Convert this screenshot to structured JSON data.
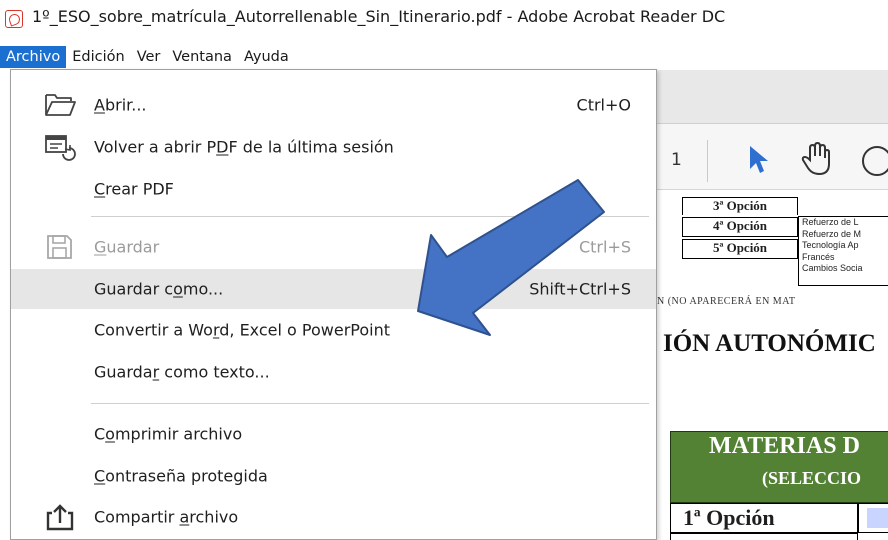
{
  "window": {
    "title": "1º_ESO_sobre_matrícula_Autorrellenable_Sin_Itinerario.pdf - Adobe Acrobat Reader DC"
  },
  "menubar": {
    "items": [
      "Archivo",
      "Edición",
      "Ver",
      "Ventana",
      "Ayuda"
    ],
    "active": "Archivo"
  },
  "file_menu": {
    "items": [
      {
        "pre": "",
        "ul": "A",
        "post": "brir...",
        "shortcut": "Ctrl+O",
        "icon": "folder-open-icon",
        "disabled": false,
        "hovered": false
      },
      {
        "pre": "Volver a abrir P",
        "ul": "D",
        "post": "F de la última sesión",
        "shortcut": "",
        "icon": "reopen-pdf-icon",
        "disabled": false,
        "hovered": false
      },
      {
        "pre": "",
        "ul": "C",
        "post": "rear PDF",
        "shortcut": "",
        "icon": "",
        "disabled": false,
        "hovered": false
      },
      {
        "pre": "",
        "ul": "G",
        "post": "uardar",
        "shortcut": "Ctrl+S",
        "icon": "save-icon",
        "disabled": true,
        "hovered": false
      },
      {
        "pre": "Guardar c",
        "ul": "o",
        "post": "mo...",
        "shortcut": "Shift+Ctrl+S",
        "icon": "",
        "disabled": false,
        "hovered": true
      },
      {
        "pre": "Convertir a Wo",
        "ul": "r",
        "post": "d, Excel o PowerPoint",
        "shortcut": "",
        "icon": "",
        "disabled": false,
        "hovered": false
      },
      {
        "pre": "Guarda",
        "ul": "r",
        "post": " como texto...",
        "shortcut": "",
        "icon": "",
        "disabled": false,
        "hovered": false
      },
      {
        "pre": "C",
        "ul": "o",
        "post": "mprimir archivo",
        "shortcut": "",
        "icon": "",
        "disabled": false,
        "hovered": false
      },
      {
        "pre": "",
        "ul": "C",
        "post": "ontraseña protegida",
        "shortcut": "",
        "icon": "",
        "disabled": false,
        "hovered": false
      },
      {
        "pre": "Compartir ",
        "ul": "a",
        "post": "rchivo",
        "shortcut": "",
        "icon": "share-icon",
        "disabled": false,
        "hovered": false
      }
    ]
  },
  "toolbar": {
    "page_number": "1"
  },
  "document": {
    "options": [
      "3ª Opción",
      "4ª Opción",
      "5ª Opción"
    ],
    "subjects": [
      "Refuerzo de L",
      "Refuerzo de M",
      "Tecnología Ap",
      "Francés",
      "Cambios Socia"
    ],
    "cut_heading": "N  (NO APARECERÁ EN MAT",
    "heading": "IÓN AUTONÓMIC",
    "table_title": "MATERIAS D",
    "table_subtitle": "(SELECCIO",
    "first_row": "1ª Opción"
  },
  "colors": {
    "menu_active": "#1a6fd0",
    "hover": "#e6e6e6",
    "table_header": "#548235",
    "arrow": "#4472c4"
  }
}
